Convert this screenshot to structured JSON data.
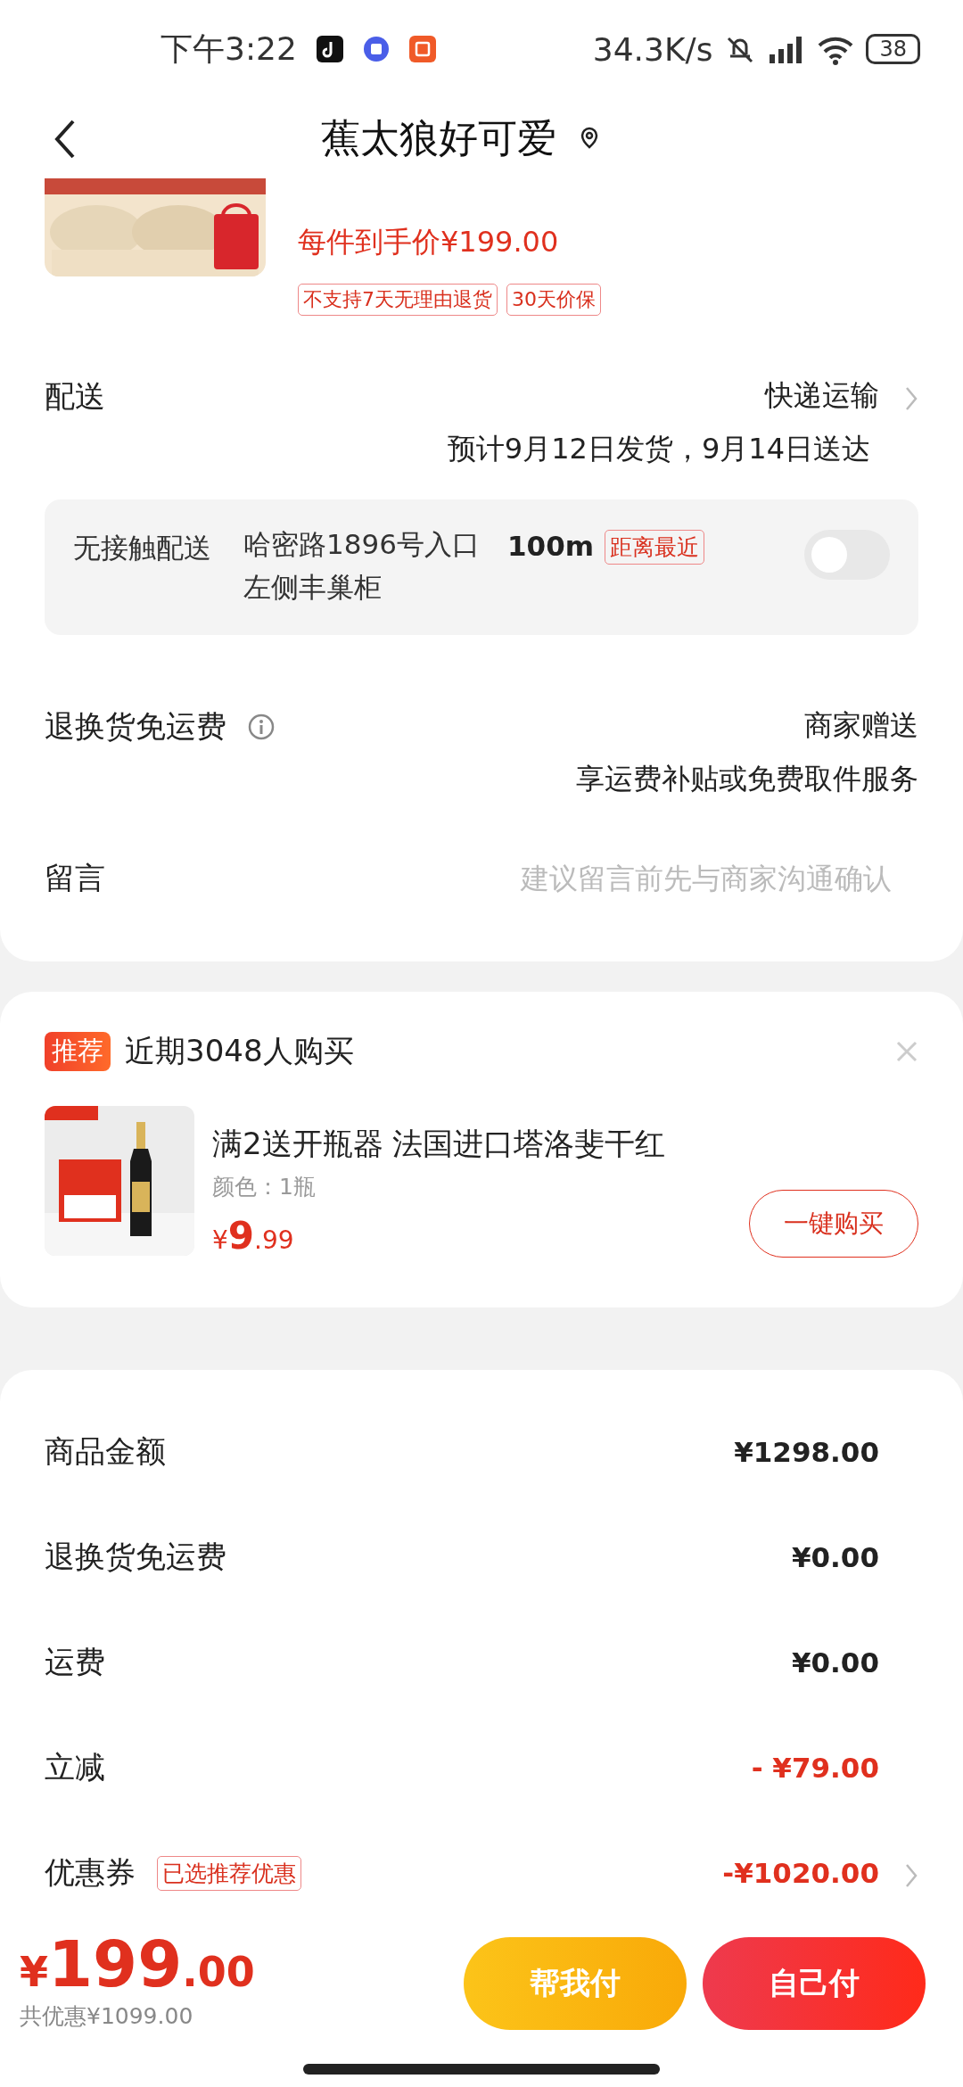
{
  "status_bar": {
    "time": "下午3:22",
    "net_speed": "34.3K/s",
    "battery": "38"
  },
  "nav": {
    "title": "蕉太狼好可爱"
  },
  "product": {
    "price_label": "每件到手价¥199.00",
    "tags": [
      "不支持7天无理由退货",
      "30天价保"
    ]
  },
  "delivery": {
    "label": "配送",
    "method": "快递运输",
    "estimate": "预计9月12日发货，9月14日送达"
  },
  "contactless": {
    "label": "无接触配送",
    "address": "哈密路1896号入口左侧丰巢柜",
    "distance": "100m",
    "badge": "距离最近",
    "on": false
  },
  "return_shipping": {
    "label": "退换货免运费",
    "value": "商家赠送",
    "note": "享运费补贴或免费取件服务"
  },
  "message": {
    "label": "留言",
    "placeholder": "建议留言前先与商家沟通确认"
  },
  "recommend": {
    "badge": "推荐",
    "headline": "近期3048人购买",
    "item": {
      "title": "满2送开瓶器 法国进口塔洛斐干红",
      "spec": "颜色：1瓶",
      "price_symbol": "¥",
      "price_int": "9",
      "price_dec": ".99",
      "button": "一键购买"
    }
  },
  "summary": [
    {
      "label": "商品金额",
      "value": "¥1298.00",
      "kind": "plain"
    },
    {
      "label": "退换货免运费",
      "value": "¥0.00",
      "kind": "plain"
    },
    {
      "label": "运费",
      "value": "¥0.00",
      "kind": "plain"
    },
    {
      "label": "立减",
      "value": "- ¥79.00",
      "kind": "discount"
    },
    {
      "label": "优惠券",
      "tag": "已选推荐优惠",
      "value": "-¥1020.00",
      "kind": "discount",
      "link": true
    }
  ],
  "footer": {
    "currency": "¥",
    "amount": "199",
    "decimals": ".00",
    "saved": "共优惠¥1099.00",
    "buttons": [
      {
        "label": "帮我付",
        "kind": "secondary"
      },
      {
        "label": "自己付",
        "kind": "primary"
      }
    ]
  }
}
